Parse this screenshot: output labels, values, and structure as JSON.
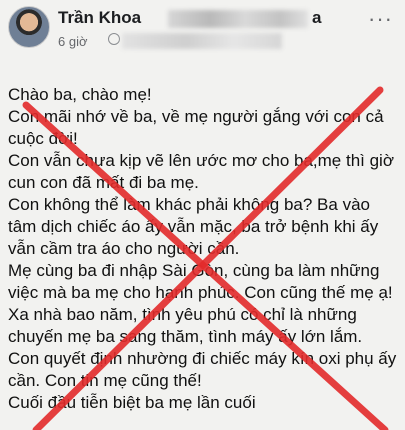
{
  "header": {
    "name": "Trần Khoa",
    "name_suffix": "a",
    "time": "6 giờ",
    "more_icon": "more-horizontal-icon"
  },
  "post": {
    "paragraphs": [
      "Chào ba, chào mẹ!",
      "Con mãi nhớ về ba, về mẹ người gắng với con cả cuộc đời!",
      "Con vẫn chưa kịp vẽ lên ước mơ cho ba,mẹ thì giờ cun con đã mất đi ba mẹ.",
      "Con không thể làm khác phải không ba? Ba vào tâm dịch chiếc áo ấy vẫn mặc, ba trở bệnh khi ấy vẫn cầm tra áo cho người cần.",
      "Mẹ cùng ba đi nhập Sài Gòn, cùng ba làm những việc mà ba mẹ cho hạnh phúc. Con cũng thế mẹ ạ!",
      "Xa nhà bao năm, tình yêu phú có chỉ là những chuyến mẹ ba sang thăm, tình máy ấy lớn lắm. Con quyết định nhường đi chiếc máy kín oxi phụ ấy cần. Con tin mẹ cũng thế!",
      "Cuối đầu tiễn biệt ba mẹ lần cuối"
    ]
  },
  "colors": {
    "cross": "#e32b2b",
    "text": "#111111",
    "meta": "#65676b"
  }
}
